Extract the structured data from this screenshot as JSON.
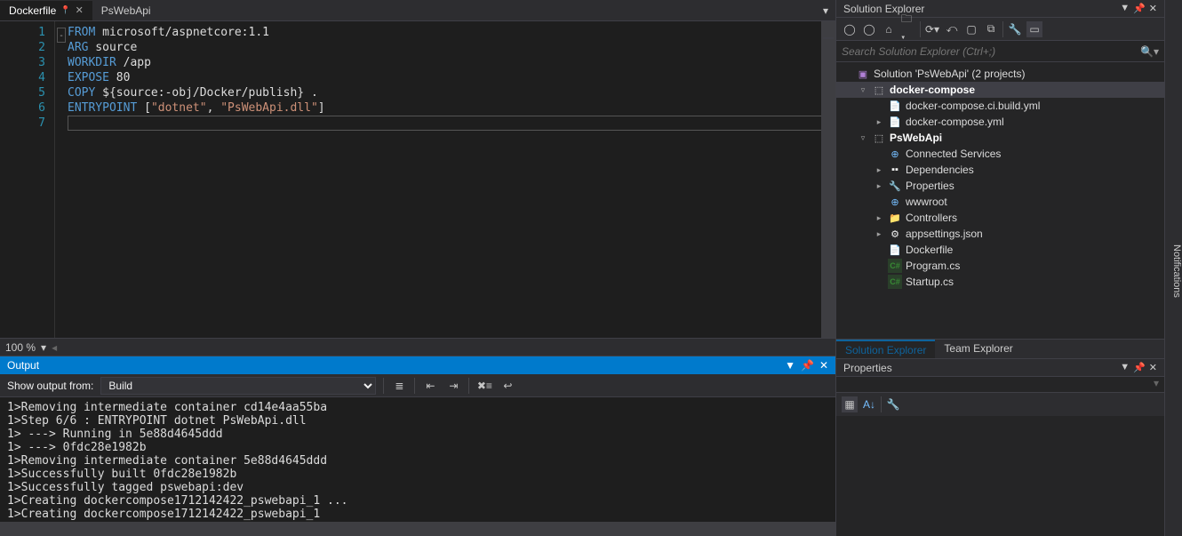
{
  "tabs": [
    {
      "label": "Dockerfile",
      "active": true,
      "pinned": true
    },
    {
      "label": "PsWebApi",
      "active": false
    }
  ],
  "code": {
    "lines": [
      {
        "n": 1,
        "tokens": [
          [
            "kw",
            "FROM"
          ],
          [
            "pln",
            " microsoft/aspnetcore:1.1"
          ]
        ]
      },
      {
        "n": 2,
        "tokens": [
          [
            "kw",
            "ARG"
          ],
          [
            "pln",
            " source"
          ]
        ]
      },
      {
        "n": 3,
        "tokens": [
          [
            "kw",
            "WORKDIR"
          ],
          [
            "pln",
            " /app"
          ]
        ]
      },
      {
        "n": 4,
        "tokens": [
          [
            "kw",
            "EXPOSE"
          ],
          [
            "pln",
            " 80"
          ]
        ]
      },
      {
        "n": 5,
        "tokens": [
          [
            "kw",
            "COPY"
          ],
          [
            "pln",
            " ${source:-obj/Docker/publish} ."
          ]
        ]
      },
      {
        "n": 6,
        "tokens": [
          [
            "kw",
            "ENTRYPOINT"
          ],
          [
            "pln",
            " ["
          ],
          [
            "str",
            "\"dotnet\""
          ],
          [
            "pln",
            ", "
          ],
          [
            "str",
            "\"PsWebApi.dll\""
          ],
          [
            "pln",
            "]"
          ]
        ]
      },
      {
        "n": 7,
        "tokens": [
          [
            "pln",
            ""
          ]
        ]
      }
    ]
  },
  "zoom": "100 %",
  "output": {
    "title": "Output",
    "fromLabel": "Show output from:",
    "fromValue": "Build",
    "lines": [
      "1>Removing intermediate container cd14e4aa55ba",
      "1>Step 6/6 : ENTRYPOINT dotnet PsWebApi.dll",
      "1> ---> Running in 5e88d4645ddd",
      "1> ---> 0fdc28e1982b",
      "1>Removing intermediate container 5e88d4645ddd",
      "1>Successfully built 0fdc28e1982b",
      "1>Successfully tagged pswebapi:dev",
      "1>Creating dockercompose1712142422_pswebapi_1 ...",
      "1>Creating dockercompose1712142422_pswebapi_1"
    ]
  },
  "solutionExplorer": {
    "title": "Solution Explorer",
    "searchPlaceholder": "Search Solution Explorer (Ctrl+;)",
    "tree": [
      {
        "depth": 0,
        "exp": "",
        "ico": "sln",
        "label": "Solution 'PsWebApi' (2 projects)"
      },
      {
        "depth": 1,
        "exp": "▿",
        "ico": "proj",
        "label": "docker-compose",
        "bold": true,
        "sel": true
      },
      {
        "depth": 2,
        "exp": "",
        "ico": "yml",
        "label": "docker-compose.ci.build.yml"
      },
      {
        "depth": 2,
        "exp": "▸",
        "ico": "yml",
        "label": "docker-compose.yml"
      },
      {
        "depth": 1,
        "exp": "▿",
        "ico": "proj",
        "label": "PsWebApi",
        "bold": true
      },
      {
        "depth": 2,
        "exp": "",
        "ico": "globe",
        "label": "Connected Services"
      },
      {
        "depth": 2,
        "exp": "▸",
        "ico": "ref",
        "label": "Dependencies"
      },
      {
        "depth": 2,
        "exp": "▸",
        "ico": "wrench",
        "label": "Properties"
      },
      {
        "depth": 2,
        "exp": "",
        "ico": "globe",
        "label": "wwwroot"
      },
      {
        "depth": 2,
        "exp": "▸",
        "ico": "folder",
        "label": "Controllers"
      },
      {
        "depth": 2,
        "exp": "▸",
        "ico": "gear",
        "label": "appsettings.json"
      },
      {
        "depth": 2,
        "exp": "",
        "ico": "file",
        "label": "Dockerfile"
      },
      {
        "depth": 2,
        "exp": "",
        "ico": "cs",
        "label": "Program.cs"
      },
      {
        "depth": 2,
        "exp": "",
        "ico": "cs",
        "label": "Startup.cs"
      }
    ],
    "tabs": [
      {
        "label": "Solution Explorer",
        "active": true
      },
      {
        "label": "Team Explorer",
        "active": false
      }
    ]
  },
  "properties": {
    "title": "Properties"
  },
  "notifications": "Notifications"
}
